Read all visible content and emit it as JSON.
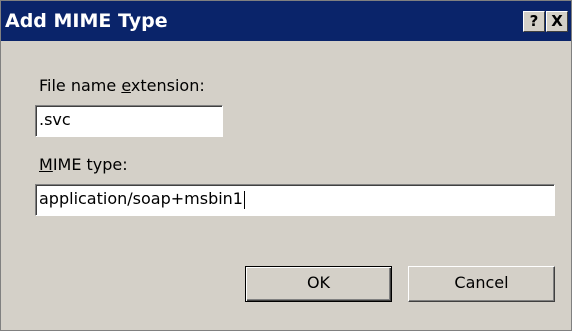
{
  "window": {
    "title": "Add MIME Type",
    "help_label": "?",
    "close_label": "X"
  },
  "form": {
    "extension_label_prefix": "File name ",
    "extension_label_accel": "e",
    "extension_label_suffix": "xtension:",
    "extension_value": ".svc",
    "mime_label_accel": "M",
    "mime_label_suffix": "IME type:",
    "mime_value": "application/soap+msbin1"
  },
  "buttons": {
    "ok_label": "OK",
    "cancel_label": "Cancel"
  },
  "colors": {
    "titlebar": "#0a246a",
    "dialog_face": "#d4d0c8"
  }
}
